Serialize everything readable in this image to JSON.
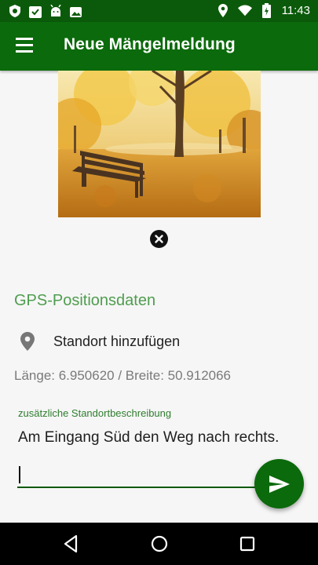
{
  "status_bar": {
    "time": "11:43",
    "left_icons": [
      "shield-icon",
      "clipboard-check-icon",
      "android-icon",
      "image-icon"
    ],
    "right_icons": [
      "location-pin-icon",
      "wifi-icon",
      "battery-charging-icon"
    ]
  },
  "app_bar": {
    "title": "Neue Mängelmeldung",
    "menu_icon": "hamburger-menu-icon"
  },
  "photo": {
    "description_icon": "autumn-park-bench-photo",
    "remove_icon": "close-circle-icon"
  },
  "gps": {
    "section_title": "GPS-Positionsdaten",
    "add_location_label": "Standort hinzufügen",
    "coordinates_text": "Länge: 6.950620 / Breite: 50.912066"
  },
  "description_field": {
    "label": "zusätzliche Standortbeschreibung",
    "value": "Am Eingang Süd den Weg nach rechts."
  },
  "fab": {
    "icon": "send-icon"
  },
  "nav_bar": {
    "icons": [
      "back-icon",
      "home-icon",
      "recents-icon"
    ]
  },
  "colors": {
    "primary": "#0b6a0b",
    "status_bar": "#0b5a0b",
    "accent_text": "#4f9d4f"
  }
}
